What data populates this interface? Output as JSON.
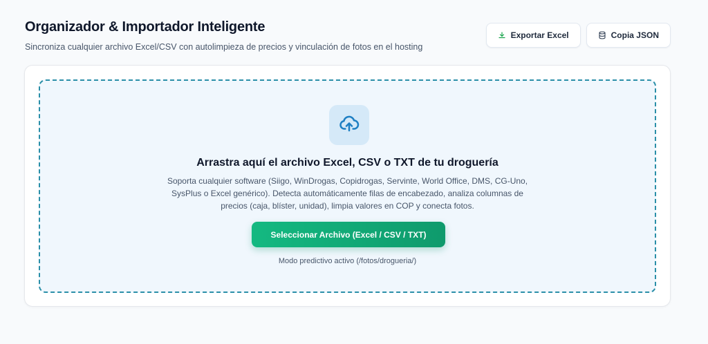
{
  "header": {
    "title": "Organizador & Importador Inteligente",
    "subtitle": "Sincroniza cualquier archivo Excel/CSV con autolimpieza de precios y vinculación de fotos en el hosting"
  },
  "actions": {
    "export_excel": {
      "label": "Exportar Excel",
      "icon": "download-icon"
    },
    "copy_json": {
      "label": "Copia JSON",
      "icon": "database-icon"
    }
  },
  "dropzone": {
    "icon": "cloud-upload-icon",
    "title": "Arrastra aquí el archivo Excel, CSV o TXT de tu droguería",
    "description": "Soporta cualquier software (Siigo, WinDrogas, Copidrogas, Servinte, World Office, DMS, CG-Uno, SysPlus o Excel genérico). Detecta automáticamente filas de encabezado, analiza columnas de precios (caja, blíster, unidad), limpia valores en COP y conecta fotos.",
    "select_button_label": "Seleccionar Archivo (Excel / CSV / TXT)",
    "hint": "Modo predictivo activo (/fotos/drogueria/)"
  },
  "colors": {
    "accent_green": "#10b981",
    "dash_border": "#2a8fa8",
    "icon_blue": "#1e7fc3",
    "export_icon_green": "#16a34a"
  }
}
